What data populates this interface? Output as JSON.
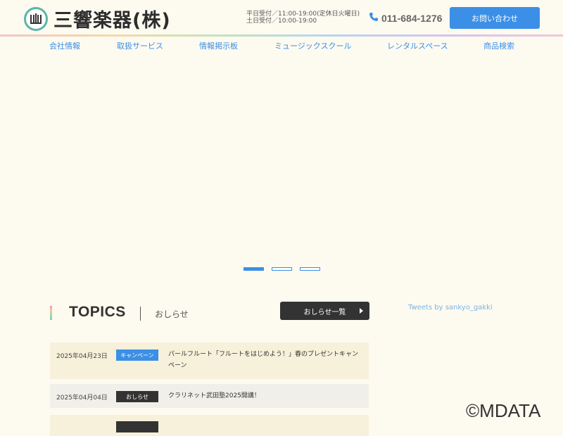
{
  "header": {
    "logo_text": "三響楽器(株)",
    "hours_line1": "平日受付／11:00-19:00(定休日火曜日)",
    "hours_line2": "土日受付／10:00-19:00",
    "phone": "011-684-1276",
    "contact_button": "お問い合わせ"
  },
  "nav": {
    "items": [
      {
        "label": "会社情報"
      },
      {
        "label": "取扱サービス"
      },
      {
        "label": "情報掲示板"
      },
      {
        "label": "ミュージックスクール"
      },
      {
        "label": "レンタルスペース"
      },
      {
        "label": "商品検索"
      }
    ]
  },
  "slider": {
    "current_slide": 1,
    "total_slides": 3
  },
  "topics": {
    "title": "TOPICS",
    "subtitle": "おしらせ",
    "list_button": "おしらせ一覧",
    "items": [
      {
        "date": "2025年04月23日",
        "badge": "キャンペーン",
        "text": "パールフルート「フルートをはじめよう！」春のプレゼントキャンペーン"
      },
      {
        "date": "2025年04月04日",
        "badge": "おしらせ",
        "text": "クラリネット武田塾2025開講！"
      }
    ]
  },
  "sidebar": {
    "tweets_link": "Tweets by sankyo_gakki"
  },
  "watermark": "©MDATA",
  "colors": {
    "accent": "#3b8fe6",
    "dark": "#333333",
    "background": "#fdfaf0"
  }
}
